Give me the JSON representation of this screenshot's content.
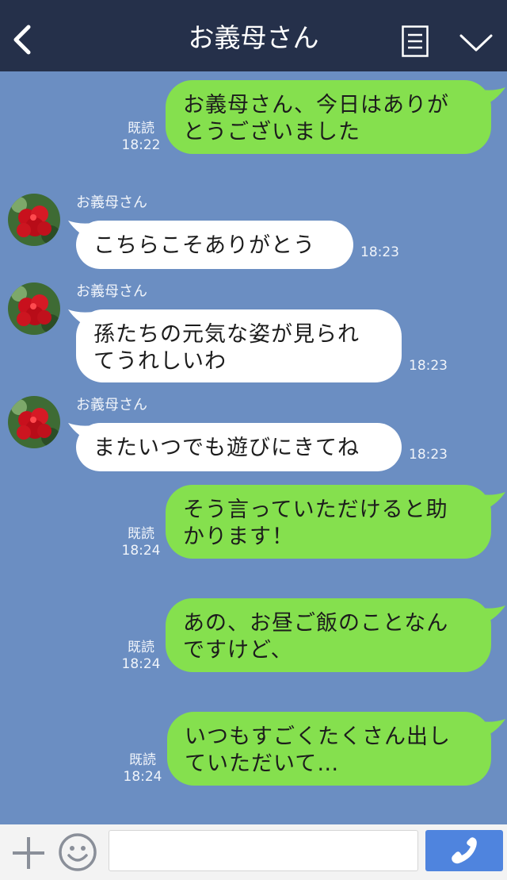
{
  "header": {
    "title": "お義母さん"
  },
  "messages": [
    {
      "side": "me",
      "lines": [
        "お義母さん、今日はありが",
        "とうございました"
      ],
      "read": "既読",
      "time": "18:22"
    },
    {
      "side": "them",
      "sender": "お義母さん",
      "lines": [
        "こちらこそありがとう"
      ],
      "time": "18:23"
    },
    {
      "side": "them",
      "sender": "お義母さん",
      "lines": [
        "孫たちの元気な姿が見られ",
        "てうれしいわ"
      ],
      "time": "18:23"
    },
    {
      "side": "them",
      "sender": "お義母さん",
      "lines": [
        "またいつでも遊びにきてね"
      ],
      "time": "18:23"
    },
    {
      "side": "me",
      "lines": [
        "そう言っていただけると助",
        "かります！"
      ],
      "read": "既読",
      "time": "18:24"
    },
    {
      "side": "me",
      "lines": [
        "あの、お昼ご飯のことなん",
        "ですけど、"
      ],
      "read": "既読",
      "time": "18:24"
    },
    {
      "side": "me",
      "lines": [
        "いつもすごくたくさん出し",
        "ていただいて…"
      ],
      "read": "既読",
      "time": "18:24"
    }
  ],
  "input": {
    "value": ""
  },
  "colors": {
    "header_bg": "#25304a",
    "chat_bg": "#6b8ec2",
    "my_bubble": "#85e04e",
    "their_bubble": "#ffffff",
    "send_button": "#4f84de"
  },
  "icons": {
    "back": "chevron-left-icon",
    "menu": "list-icon",
    "collapse": "chevron-down-icon",
    "add": "plus-icon",
    "emoji": "smiley-icon",
    "call": "phone-icon"
  }
}
